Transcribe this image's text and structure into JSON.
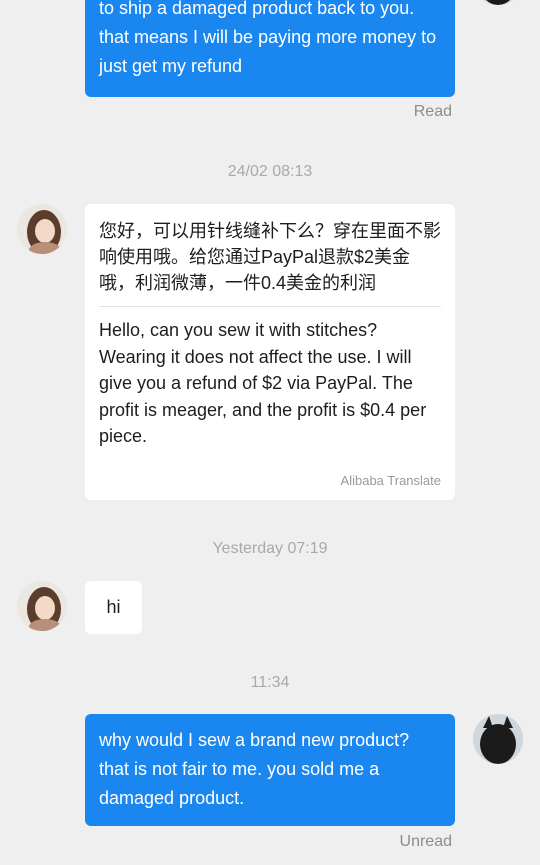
{
  "messages": {
    "m1": {
      "text": "to ship a damaged product back to you. that means I will be paying more money to just get my refund",
      "status": "Read"
    },
    "sep1": "24/02 08:13",
    "m2": {
      "original": "您好，可以用针线缝补下么？穿在里面不影响使用哦。给您通过PayPal退款$2美金哦，利润微薄，一件0.4美金的利润",
      "translation": "Hello, can you sew it with stitches? Wearing it does not affect the use. I will give you a refund of $2 via PayPal. The profit is meager, and the profit is $0.4 per piece.",
      "translator": "Alibaba Translate"
    },
    "sep2": "Yesterday 07:19",
    "m3": {
      "text": "hi"
    },
    "sep3": "11:34",
    "m4": {
      "text": "why would I sew a brand new product? that is not fair to me. you sold me a damaged product.",
      "status": "Unread"
    }
  },
  "colors": {
    "outgoing_bubble": "#1a86f0",
    "incoming_bubble": "#ffffff",
    "background": "#efefef"
  },
  "icons": {
    "seller_avatar": "seller-avatar-photo",
    "buyer_avatar": "buyer-avatar-photo"
  }
}
